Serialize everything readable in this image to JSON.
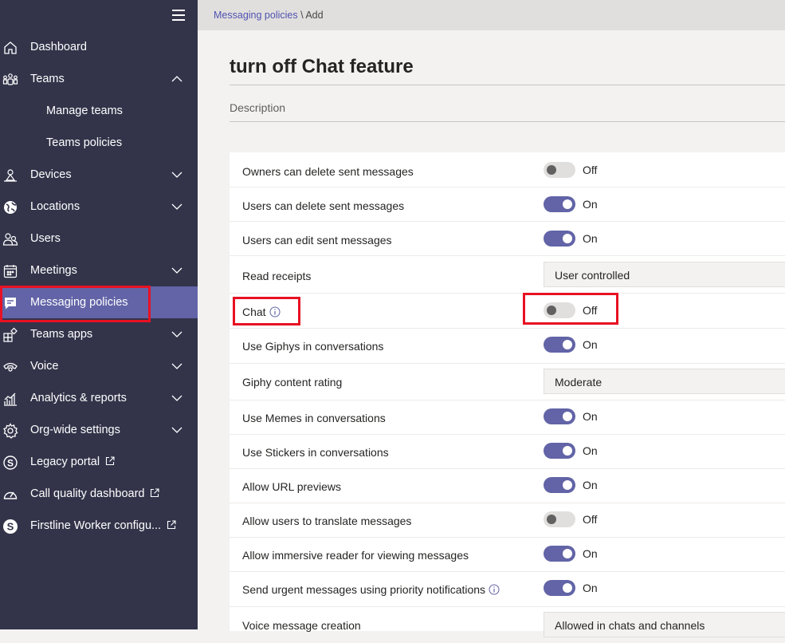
{
  "sidebar": {
    "menu_icon": "hamburger-icon",
    "items": [
      {
        "label": "Dashboard",
        "icon": "home-icon"
      },
      {
        "label": "Teams",
        "icon": "teams-icon",
        "expanded": true
      },
      {
        "label": "Manage teams"
      },
      {
        "label": "Teams policies"
      },
      {
        "label": "Devices",
        "icon": "devices-icon"
      },
      {
        "label": "Locations",
        "icon": "globe-icon"
      },
      {
        "label": "Users",
        "icon": "users-icon"
      },
      {
        "label": "Meetings",
        "icon": "calendar-icon"
      },
      {
        "label": "Messaging policies",
        "icon": "chat-icon",
        "active": true
      },
      {
        "label": "Teams apps",
        "icon": "apps-icon"
      },
      {
        "label": "Voice",
        "icon": "phone-icon"
      },
      {
        "label": "Analytics & reports",
        "icon": "analytics-icon"
      },
      {
        "label": "Org-wide settings",
        "icon": "gear-icon"
      },
      {
        "label": "Legacy portal",
        "icon": "skype-icon",
        "external": true
      },
      {
        "label": "Call quality dashboard",
        "icon": "gauge-icon",
        "external": true
      },
      {
        "label": "Firstline Worker configu...",
        "icon": "skype-icon",
        "external": true
      }
    ]
  },
  "breadcrumb": {
    "parent": "Messaging policies",
    "separator": " \\ ",
    "current": "Add"
  },
  "page": {
    "title": "turn off Chat feature",
    "description_placeholder": "Description"
  },
  "settings": [
    {
      "label": "Owners can delete sent messages",
      "type": "toggle",
      "state": "Off"
    },
    {
      "label": "Users can delete sent messages",
      "type": "toggle",
      "state": "On"
    },
    {
      "label": "Users can edit sent messages",
      "type": "toggle",
      "state": "On"
    },
    {
      "label": "Read receipts",
      "type": "dropdown",
      "value": "User controlled"
    },
    {
      "label": "Chat",
      "type": "toggle",
      "state": "Off",
      "info": true
    },
    {
      "label": "Use Giphys in conversations",
      "type": "toggle",
      "state": "On"
    },
    {
      "label": "Giphy content rating",
      "type": "dropdown",
      "value": "Moderate"
    },
    {
      "label": "Use Memes in conversations",
      "type": "toggle",
      "state": "On"
    },
    {
      "label": "Use Stickers in conversations",
      "type": "toggle",
      "state": "On"
    },
    {
      "label": "Allow URL previews",
      "type": "toggle",
      "state": "On"
    },
    {
      "label": "Allow users to translate messages",
      "type": "toggle",
      "state": "Off"
    },
    {
      "label": "Allow immersive reader for viewing messages",
      "type": "toggle",
      "state": "On"
    },
    {
      "label": "Send urgent messages using priority notifications",
      "type": "toggle",
      "state": "On",
      "info": true
    },
    {
      "label": "Voice message creation",
      "type": "dropdown",
      "value": "Allowed in chats and channels"
    }
  ],
  "colors": {
    "sidebar_bg": "#33344a",
    "active_bg": "#6264a7",
    "toggle_on": "#6264a7",
    "highlight_box": "#e81123"
  }
}
